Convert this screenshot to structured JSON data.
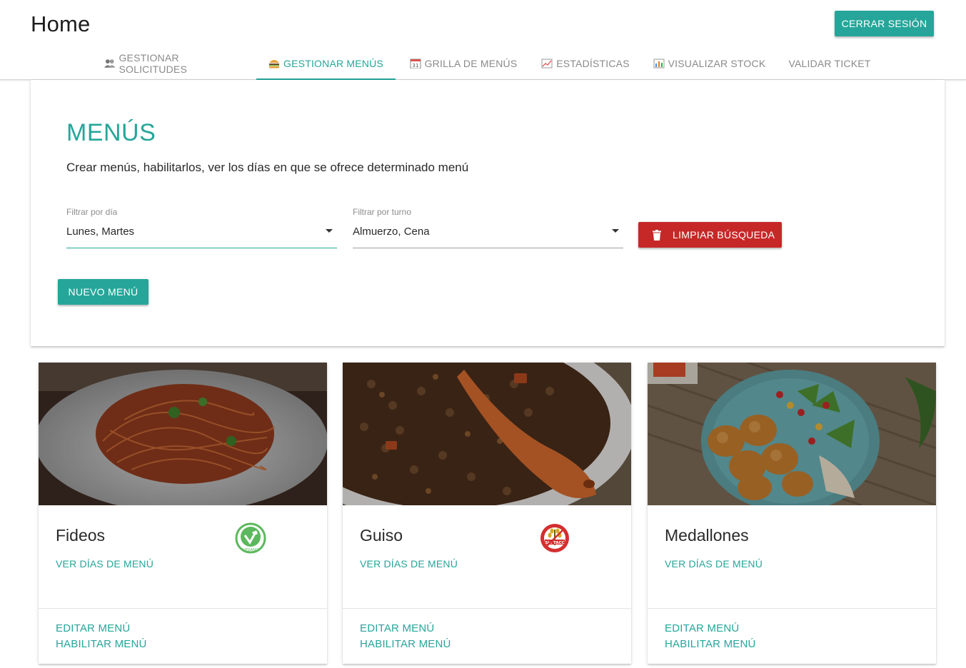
{
  "header": {
    "title": "Home",
    "logout_label": "CERRAR SESIÓN"
  },
  "tabs": [
    {
      "label": "GESTIONAR SOLICITUDES",
      "icon": "users-icon",
      "active": false
    },
    {
      "label": "GESTIONAR MENÚS",
      "icon": "burger-icon",
      "active": true
    },
    {
      "label": "GRILLA DE MENÚS",
      "icon": "calendar-icon",
      "active": false
    },
    {
      "label": "ESTADÍSTICAS",
      "icon": "line-chart-icon",
      "active": false
    },
    {
      "label": "VISUALIZAR STOCK",
      "icon": "bar-chart-icon",
      "active": false
    },
    {
      "label": "VALIDAR TICKET",
      "icon": "",
      "active": false
    }
  ],
  "panel": {
    "title": "MENÚS",
    "description": "Crear menús, habilitarlos, ver los días en que se ofrece determinado menú",
    "filter_day": {
      "label": "Filtrar por día",
      "value": "Lunes, Martes"
    },
    "filter_shift": {
      "label": "Filtrar por turno",
      "value": "Almuerzo, Cena"
    },
    "clear_label": "LIMPIAR BÚSQUEDA",
    "new_label": "NUEVO MENÚ"
  },
  "cards": [
    {
      "name": "Fideos",
      "link": "VER DÍAS DE MENÚ",
      "edit": "EDITAR MENÚ",
      "enable": "HABILITAR MENÚ",
      "badge": "vegan-badge-icon",
      "badge_text": "VEGANO"
    },
    {
      "name": "Guiso",
      "link": "VER DÍAS DE MENÚ",
      "edit": "EDITAR MENÚ",
      "enable": "HABILITAR MENÚ",
      "badge": "sin-tacc-badge-icon",
      "badge_text": "Sin TACC"
    },
    {
      "name": "Medallones",
      "link": "VER DÍAS DE MENÚ",
      "edit": "EDITAR MENÚ",
      "enable": "HABILITAR MENÚ",
      "badge": "",
      "badge_text": ""
    }
  ],
  "colors": {
    "accent": "#26a69a",
    "danger": "#c62828"
  }
}
